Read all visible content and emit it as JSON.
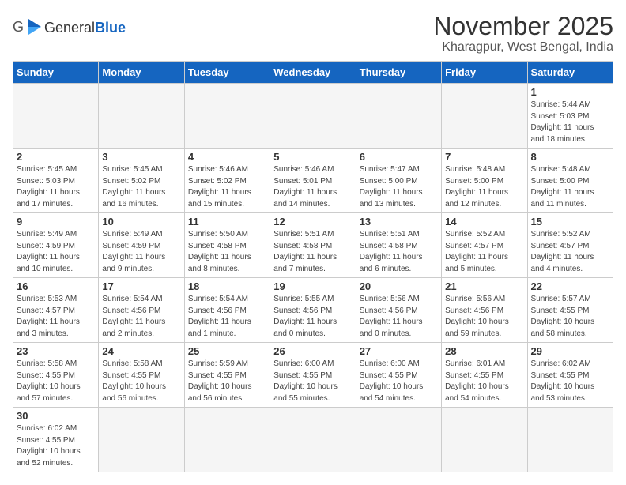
{
  "header": {
    "logo_general": "General",
    "logo_blue": "Blue",
    "month_title": "November 2025",
    "location": "Kharagpur, West Bengal, India"
  },
  "days_of_week": [
    "Sunday",
    "Monday",
    "Tuesday",
    "Wednesday",
    "Thursday",
    "Friday",
    "Saturday"
  ],
  "weeks": [
    [
      {
        "day": "",
        "info": ""
      },
      {
        "day": "",
        "info": ""
      },
      {
        "day": "",
        "info": ""
      },
      {
        "day": "",
        "info": ""
      },
      {
        "day": "",
        "info": ""
      },
      {
        "day": "",
        "info": ""
      },
      {
        "day": "1",
        "info": "Sunrise: 5:44 AM\nSunset: 5:03 PM\nDaylight: 11 hours\nand 18 minutes."
      }
    ],
    [
      {
        "day": "2",
        "info": "Sunrise: 5:45 AM\nSunset: 5:03 PM\nDaylight: 11 hours\nand 17 minutes."
      },
      {
        "day": "3",
        "info": "Sunrise: 5:45 AM\nSunset: 5:02 PM\nDaylight: 11 hours\nand 16 minutes."
      },
      {
        "day": "4",
        "info": "Sunrise: 5:46 AM\nSunset: 5:02 PM\nDaylight: 11 hours\nand 15 minutes."
      },
      {
        "day": "5",
        "info": "Sunrise: 5:46 AM\nSunset: 5:01 PM\nDaylight: 11 hours\nand 14 minutes."
      },
      {
        "day": "6",
        "info": "Sunrise: 5:47 AM\nSunset: 5:00 PM\nDaylight: 11 hours\nand 13 minutes."
      },
      {
        "day": "7",
        "info": "Sunrise: 5:48 AM\nSunset: 5:00 PM\nDaylight: 11 hours\nand 12 minutes."
      },
      {
        "day": "8",
        "info": "Sunrise: 5:48 AM\nSunset: 5:00 PM\nDaylight: 11 hours\nand 11 minutes."
      }
    ],
    [
      {
        "day": "9",
        "info": "Sunrise: 5:49 AM\nSunset: 4:59 PM\nDaylight: 11 hours\nand 10 minutes."
      },
      {
        "day": "10",
        "info": "Sunrise: 5:49 AM\nSunset: 4:59 PM\nDaylight: 11 hours\nand 9 minutes."
      },
      {
        "day": "11",
        "info": "Sunrise: 5:50 AM\nSunset: 4:58 PM\nDaylight: 11 hours\nand 8 minutes."
      },
      {
        "day": "12",
        "info": "Sunrise: 5:51 AM\nSunset: 4:58 PM\nDaylight: 11 hours\nand 7 minutes."
      },
      {
        "day": "13",
        "info": "Sunrise: 5:51 AM\nSunset: 4:58 PM\nDaylight: 11 hours\nand 6 minutes."
      },
      {
        "day": "14",
        "info": "Sunrise: 5:52 AM\nSunset: 4:57 PM\nDaylight: 11 hours\nand 5 minutes."
      },
      {
        "day": "15",
        "info": "Sunrise: 5:52 AM\nSunset: 4:57 PM\nDaylight: 11 hours\nand 4 minutes."
      }
    ],
    [
      {
        "day": "16",
        "info": "Sunrise: 5:53 AM\nSunset: 4:57 PM\nDaylight: 11 hours\nand 3 minutes."
      },
      {
        "day": "17",
        "info": "Sunrise: 5:54 AM\nSunset: 4:56 PM\nDaylight: 11 hours\nand 2 minutes."
      },
      {
        "day": "18",
        "info": "Sunrise: 5:54 AM\nSunset: 4:56 PM\nDaylight: 11 hours\nand 1 minute."
      },
      {
        "day": "19",
        "info": "Sunrise: 5:55 AM\nSunset: 4:56 PM\nDaylight: 11 hours\nand 0 minutes."
      },
      {
        "day": "20",
        "info": "Sunrise: 5:56 AM\nSunset: 4:56 PM\nDaylight: 11 hours\nand 0 minutes."
      },
      {
        "day": "21",
        "info": "Sunrise: 5:56 AM\nSunset: 4:56 PM\nDaylight: 10 hours\nand 59 minutes."
      },
      {
        "day": "22",
        "info": "Sunrise: 5:57 AM\nSunset: 4:55 PM\nDaylight: 10 hours\nand 58 minutes."
      }
    ],
    [
      {
        "day": "23",
        "info": "Sunrise: 5:58 AM\nSunset: 4:55 PM\nDaylight: 10 hours\nand 57 minutes."
      },
      {
        "day": "24",
        "info": "Sunrise: 5:58 AM\nSunset: 4:55 PM\nDaylight: 10 hours\nand 56 minutes."
      },
      {
        "day": "25",
        "info": "Sunrise: 5:59 AM\nSunset: 4:55 PM\nDaylight: 10 hours\nand 56 minutes."
      },
      {
        "day": "26",
        "info": "Sunrise: 6:00 AM\nSunset: 4:55 PM\nDaylight: 10 hours\nand 55 minutes."
      },
      {
        "day": "27",
        "info": "Sunrise: 6:00 AM\nSunset: 4:55 PM\nDaylight: 10 hours\nand 54 minutes."
      },
      {
        "day": "28",
        "info": "Sunrise: 6:01 AM\nSunset: 4:55 PM\nDaylight: 10 hours\nand 54 minutes."
      },
      {
        "day": "29",
        "info": "Sunrise: 6:02 AM\nSunset: 4:55 PM\nDaylight: 10 hours\nand 53 minutes."
      }
    ],
    [
      {
        "day": "30",
        "info": "Sunrise: 6:02 AM\nSunset: 4:55 PM\nDaylight: 10 hours\nand 52 minutes."
      },
      {
        "day": "",
        "info": ""
      },
      {
        "day": "",
        "info": ""
      },
      {
        "day": "",
        "info": ""
      },
      {
        "day": "",
        "info": ""
      },
      {
        "day": "",
        "info": ""
      },
      {
        "day": "",
        "info": ""
      }
    ]
  ]
}
